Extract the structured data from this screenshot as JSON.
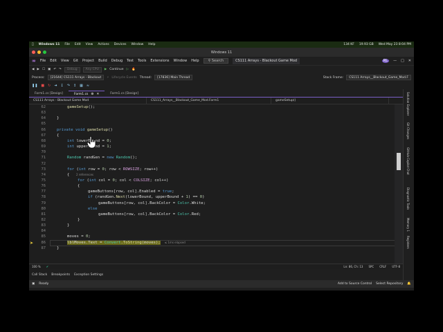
{
  "mac_bar": {
    "app": "Windows 11",
    "menus": [
      "File",
      "Edit",
      "View",
      "Actions",
      "Devices",
      "Window",
      "Help"
    ],
    "battery": "134 KF",
    "temp": "19.93 GB",
    "clock": "Wed May 23  8:04 PM"
  },
  "window": {
    "title": "Windows 11"
  },
  "menu": {
    "items": [
      "File",
      "Edit",
      "View",
      "Git",
      "Project",
      "Build",
      "Debug",
      "Test",
      "Tools",
      "Extensions",
      "Window",
      "Help"
    ],
    "search": "Search",
    "solution": "CS111 Arrays - Blackout Game Mod",
    "user_initials": "RL"
  },
  "toolbar": {
    "config": "Debug",
    "platform": "Any CPU",
    "continue": "Continue"
  },
  "process": {
    "label": "Process:",
    "value": "[21644] CS111 Arrays - Blackout",
    "lifecycle": "Lifecycle Events",
    "thread_label": "Thread:",
    "thread": "[17836] Main Thread",
    "stack_label": "Stack Frame:",
    "stack": "CS111 Arrays__Blackout_Game_Mod.F"
  },
  "tabs": [
    "Form1.cs [Design]",
    "Form1.cs",
    "Form1.cs [Design]"
  ],
  "navbar": {
    "project": "CS111 Arrays - Blackout Game Mod",
    "class": "CS111_Arrays__Blackout_Game_Mod.Form1",
    "member": "gameSetup()"
  },
  "code_lines": [
    {
      "n": "62",
      "t": "gameSetup();",
      "indent": 3
    },
    {
      "n": "63",
      "t": "",
      "indent": 0
    },
    {
      "n": "64",
      "t": "}",
      "indent": 2
    },
    {
      "n": "65",
      "t": "",
      "indent": 0
    },
    {
      "n": "66",
      "t": "private void gameSetup()",
      "indent": 2
    },
    {
      "n": "67",
      "t": "{",
      "indent": 2
    },
    {
      "n": "68",
      "t": "int lowerBound = 0;",
      "indent": 3
    },
    {
      "n": "69",
      "t": "int upperBound = 1;",
      "indent": 3
    },
    {
      "n": "70",
      "t": "",
      "indent": 0
    },
    {
      "n": "71",
      "t": "Random randGen = new Random();",
      "indent": 3
    },
    {
      "n": "72",
      "t": "",
      "indent": 0
    },
    {
      "n": "73",
      "t": "for (int row = 0; row < ROWSIZE; row++)",
      "indent": 3
    },
    {
      "n": "74",
      "t": "{",
      "indent": 3
    },
    {
      "n": "75",
      "t": "for (int col = 0; col < COLSIZE; col++)",
      "indent": 4
    },
    {
      "n": "76",
      "t": "{",
      "indent": 4
    },
    {
      "n": "77",
      "t": "gameButtons[row, col].Enabled = true;",
      "indent": 5
    },
    {
      "n": "78",
      "t": "if (randGen.Next(lowerBound, upperBound + 1) == 0)",
      "indent": 5
    },
    {
      "n": "79",
      "t": "gameButtons[row, col].BackColor = Color.White;",
      "indent": 6
    },
    {
      "n": "80",
      "t": "else",
      "indent": 5
    },
    {
      "n": "81",
      "t": "gameButtons[row, col].BackColor = Color.Red;",
      "indent": 6
    },
    {
      "n": "82",
      "t": "}",
      "indent": 4
    },
    {
      "n": "83",
      "t": "}",
      "indent": 3
    },
    {
      "n": "84",
      "t": "",
      "indent": 0
    },
    {
      "n": "85",
      "t": "moves = 0;",
      "indent": 3
    },
    {
      "n": "86",
      "t": "lblMoves.Text = Convert.ToString(moves);",
      "indent": 3
    },
    {
      "n": "87",
      "t": "}",
      "indent": 2
    }
  ],
  "references_hint": "2 references",
  "elapsed_hint": "≤ 1ms elapsed",
  "editor_status": {
    "zoom": "100 %",
    "position": "Ln: 86, Ch: 13",
    "spaces": "SPC",
    "eol": "CRLF",
    "encoding": "UTF-8"
  },
  "bottom_tabs": [
    "Call Stack",
    "Breakpoints",
    "Exception Settings"
  ],
  "status": {
    "ready": "Ready",
    "source_control": "Add to Source Control",
    "repo": "Select Repository"
  },
  "side_tabs": [
    "Solution Explorer",
    "Git Changes",
    "GitHub Copilot Chat",
    "Diagnostic Tools",
    "Memory 1",
    "Registers"
  ]
}
